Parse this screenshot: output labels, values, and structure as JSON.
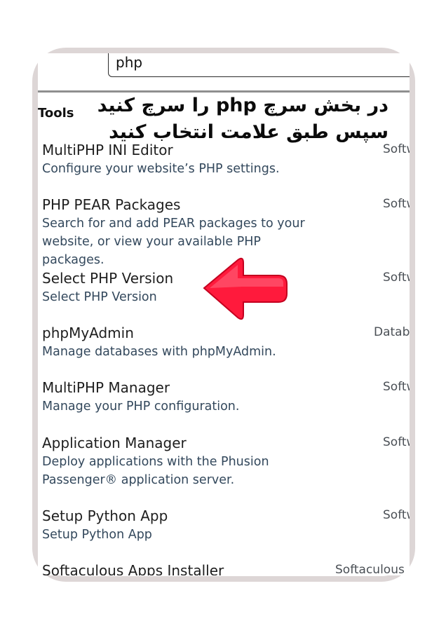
{
  "search": {
    "value": "php"
  },
  "section": {
    "title": "Tools"
  },
  "overlay": {
    "line1": "در بخش سرچ php را سرچ کنید",
    "line2": "سپس طبق علامت انتخاب کنید"
  },
  "results": [
    {
      "title": "MultiPHP INI Editor",
      "description": "Configure your website’s PHP settings.",
      "category": "Softw"
    },
    {
      "title": "PHP PEAR Packages",
      "description": "Search for and add PEAR packages to your website, or view your available PHP packages.",
      "category": "Softw"
    },
    {
      "title": "Select PHP Version",
      "description": "Select PHP Version",
      "category": "Softw"
    },
    {
      "title": "phpMyAdmin",
      "description": "Manage databases with phpMyAdmin.",
      "category": "Datab"
    },
    {
      "title": "MultiPHP Manager",
      "description": "Manage your PHP configuration.",
      "category": "Softw"
    },
    {
      "title": "Application Manager",
      "description": "Deploy applications with the Phusion Passenger® application server.",
      "category": "Softw"
    },
    {
      "title": "Setup Python App",
      "description": "Setup Python App",
      "category": "Softw"
    },
    {
      "title": "Softaculous Apps Installer",
      "description": "",
      "category": "Softaculous"
    }
  ],
  "colors": {
    "frame": "#ddd6d6",
    "arrow": "#ff1a3c",
    "description": "#33485c"
  },
  "icons": {
    "pointer": "red-arrow-left-icon"
  }
}
